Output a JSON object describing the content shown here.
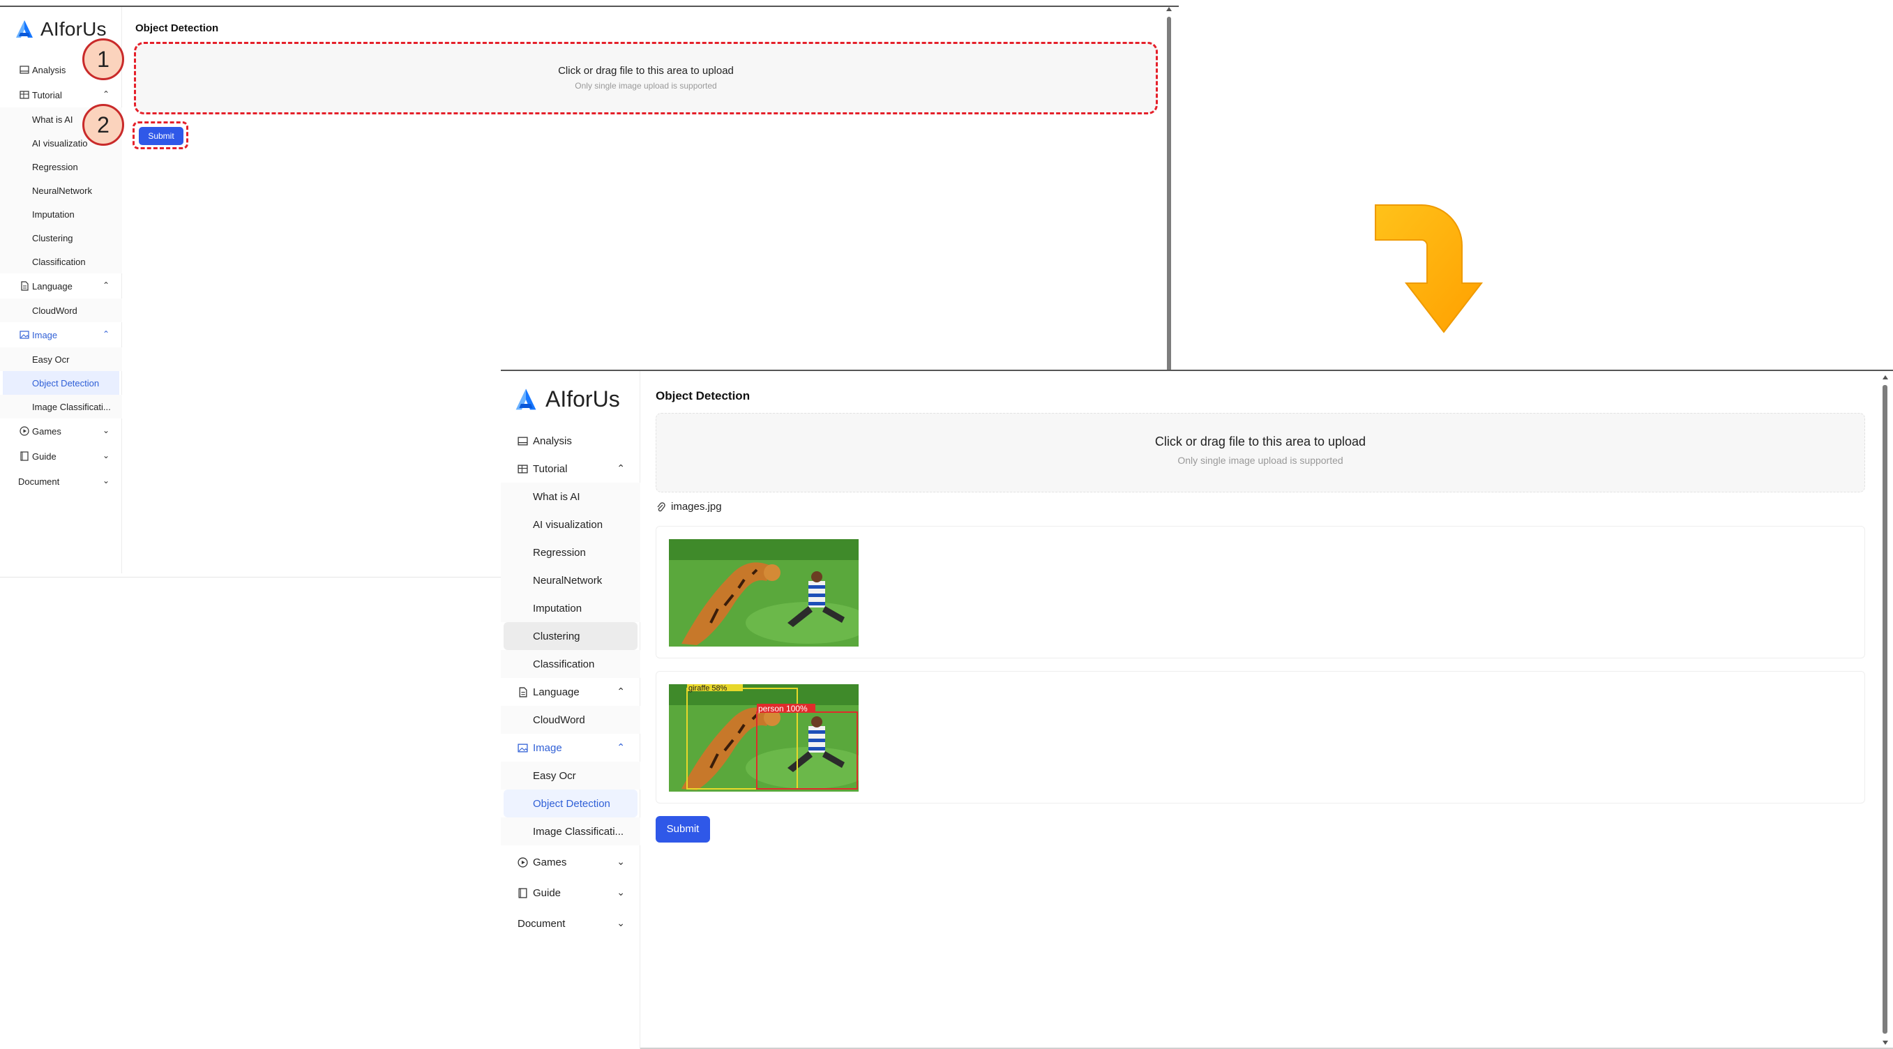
{
  "app": {
    "name": "AIforUs"
  },
  "sidebar": {
    "items": [
      {
        "label": "Analysis",
        "icon": "dashboard-icon"
      },
      {
        "label": "Tutorial",
        "icon": "table-icon",
        "expanded": true,
        "children": [
          "What is AI",
          "AI visualization",
          "Regression",
          "NeuralNetwork",
          "Imputation",
          "Clustering",
          "Classification"
        ]
      },
      {
        "label": "Language",
        "icon": "file-text-icon",
        "expanded": true,
        "children": [
          "CloudWord"
        ]
      },
      {
        "label": "Image",
        "icon": "picture-icon",
        "expanded": true,
        "children": [
          "Easy Ocr",
          "Object Detection",
          "Image Classificati..."
        ]
      },
      {
        "label": "Games",
        "icon": "play-circle-icon",
        "expanded": false
      },
      {
        "label": "Guide",
        "icon": "book-icon",
        "expanded": false
      },
      {
        "label": "Document",
        "expanded": false
      }
    ],
    "screen1_truncated_item": "AI visualizatio"
  },
  "page": {
    "title": "Object Detection",
    "upload": {
      "primary_text": "Click or drag file to this area to upload",
      "hint_text": "Only single image upload is supported"
    },
    "file_name": "images.jpg",
    "submit_label": "Submit"
  },
  "result_image": {
    "labels": [
      "giraffe 58%",
      "person 100%"
    ]
  },
  "annotations": {
    "step1": "1",
    "step2": "2"
  },
  "colors": {
    "accent": "#2f58e8",
    "active_text": "#2f5fd6",
    "highlight_dash": "#e5202a",
    "badge_fill": "#fbd3bd",
    "arrow": "#ffb300"
  }
}
